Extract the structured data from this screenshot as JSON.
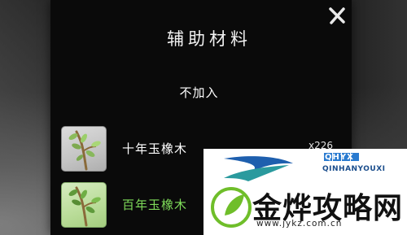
{
  "dialog": {
    "title": "辅助材料",
    "none_option": "不加入"
  },
  "items": [
    {
      "name": "十年玉橡木",
      "count": "x226",
      "name_color": "#ffffff",
      "icon": "jade-oak-sapling-icon"
    },
    {
      "name": "百年玉橡木",
      "count": "",
      "name_color": "#7fdc5a",
      "icon": "jade-oak-sapling-icon"
    }
  ],
  "watermark": {
    "top_text": "QHYX",
    "brand_en": "QINHANYOUXI",
    "brand_cn": "金烨攻略网",
    "url": "www.jykz.com.cn"
  },
  "colors": {
    "panel": "#0a0a0a",
    "common_item_name": "#ffffff",
    "rare_item_name": "#7fdc5a"
  }
}
